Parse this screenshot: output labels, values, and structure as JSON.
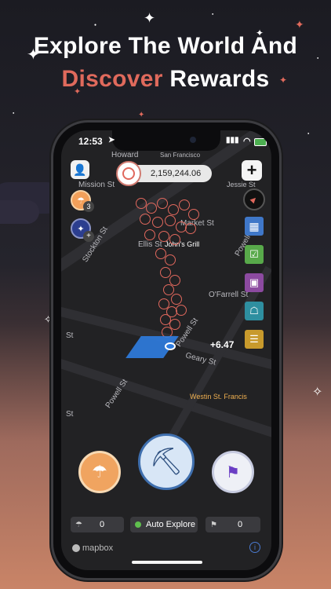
{
  "headline": {
    "line1": "Explore The World And",
    "line2_accent": "Discover",
    "line2_rest": "Rewards"
  },
  "colors": {
    "accent": "#e06a5c",
    "dark": "#1b1b22",
    "sand": "#c98467"
  },
  "status_bar": {
    "time": "12:53",
    "location_icon": "location-arrow-icon",
    "icons": [
      "signal-icon",
      "wifi-icon",
      "battery-icon"
    ]
  },
  "balance": {
    "amount": "2,159,244.06",
    "icon": "coin-icon"
  },
  "map": {
    "streets": [
      "Howard",
      "San Francisco",
      "Mission St",
      "Jessie St",
      "Stockton St",
      "Market St",
      "Ellis St",
      "John's Grill",
      "Powell St",
      "O'Farrell St",
      "St",
      "Powell St",
      "Geary St",
      "St",
      "Powell St",
      "Westin St. Francis"
    ],
    "gain": "+6.47"
  },
  "left_buttons": {
    "airdrop_badge": "3"
  },
  "bottom_bar": {
    "airdrop_count": "0",
    "auto_explore_label": "Auto Explore",
    "flag_count": "0"
  },
  "footer": {
    "brand": "mapbox",
    "info_icon": "info-icon"
  }
}
